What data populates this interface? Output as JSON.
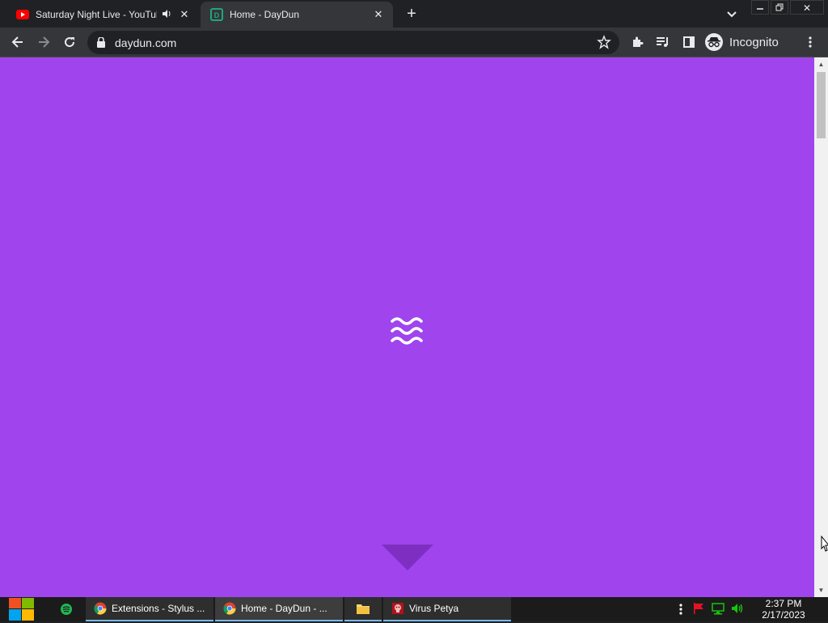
{
  "browser": {
    "tabs": [
      {
        "title": "Saturday Night Live - YouTube",
        "icon": "youtube-icon",
        "audio": "speaker-icon"
      },
      {
        "title": "Home - DayDun",
        "icon": "daydun-icon",
        "active": true
      }
    ],
    "address": "daydun.com",
    "profile_label": "Incognito"
  },
  "page": {
    "background": "#a044ee",
    "logo": "waves-icon",
    "scroll_hint": "down-arrow-icon"
  },
  "taskbar": {
    "apps": [
      {
        "label": "Extensions - Stylus ...",
        "icon": "chrome-icon"
      },
      {
        "label": "Home - DayDun - ...",
        "icon": "chrome-icon"
      },
      {
        "label": "",
        "icon": "file-explorer-icon"
      },
      {
        "label": "Virus Petya",
        "icon": "skull-icon"
      }
    ],
    "time": "2:37 PM",
    "date": "2/17/2023"
  }
}
